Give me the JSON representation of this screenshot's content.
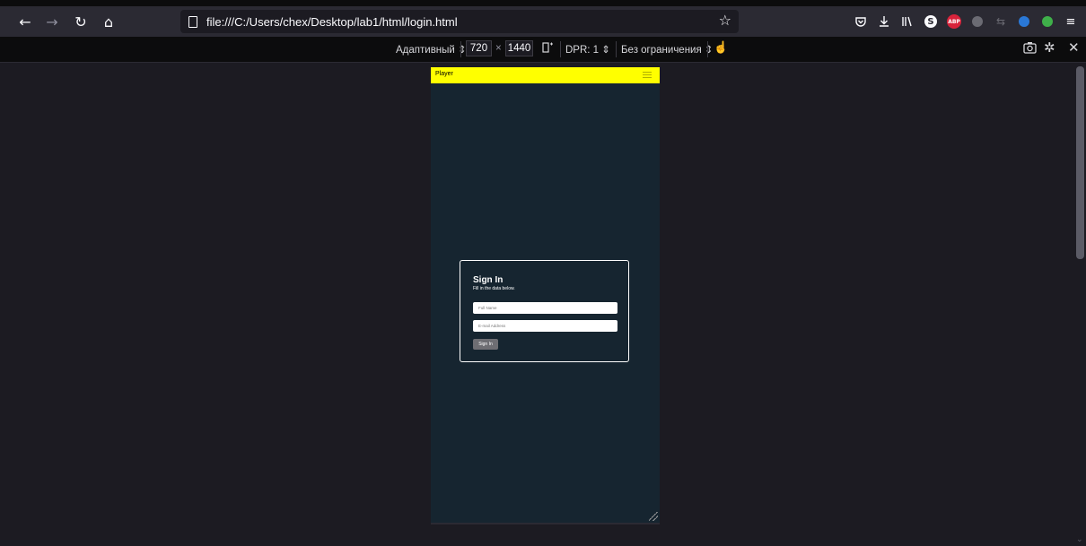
{
  "browser": {
    "url": "file:///C:/Users/chex/Desktop/lab1/html/login.html"
  },
  "rdm": {
    "mode": "Адаптивный ⇕",
    "width": "720",
    "times": "×",
    "height": "1440",
    "dpr": "DPR: 1 ⇕",
    "throttle": "Без ограничения ⇕"
  },
  "app": {
    "brand": "Player",
    "signin": {
      "title": "Sign In",
      "subtitle": "Fill in the data below.",
      "name_placeholder": "Full Name",
      "email_placeholder": "E-mail Address",
      "button": "Sign In"
    }
  },
  "colors": {
    "header_bg": "#ffff00",
    "page_bg": "#162530",
    "toolbar_bg": "#2b2a33"
  },
  "icons": [
    "back-icon",
    "forward-icon",
    "reload-icon",
    "home-icon",
    "page-icon",
    "star-icon",
    "pocket-icon",
    "download-icon",
    "library-icon",
    "sync-icon",
    "adblock-icon",
    "menu-icon",
    "rotate-icon",
    "touch-icon",
    "screenshot-icon",
    "settings-icon",
    "close-icon",
    "hamburger-icon",
    "resize-grip-icon"
  ]
}
